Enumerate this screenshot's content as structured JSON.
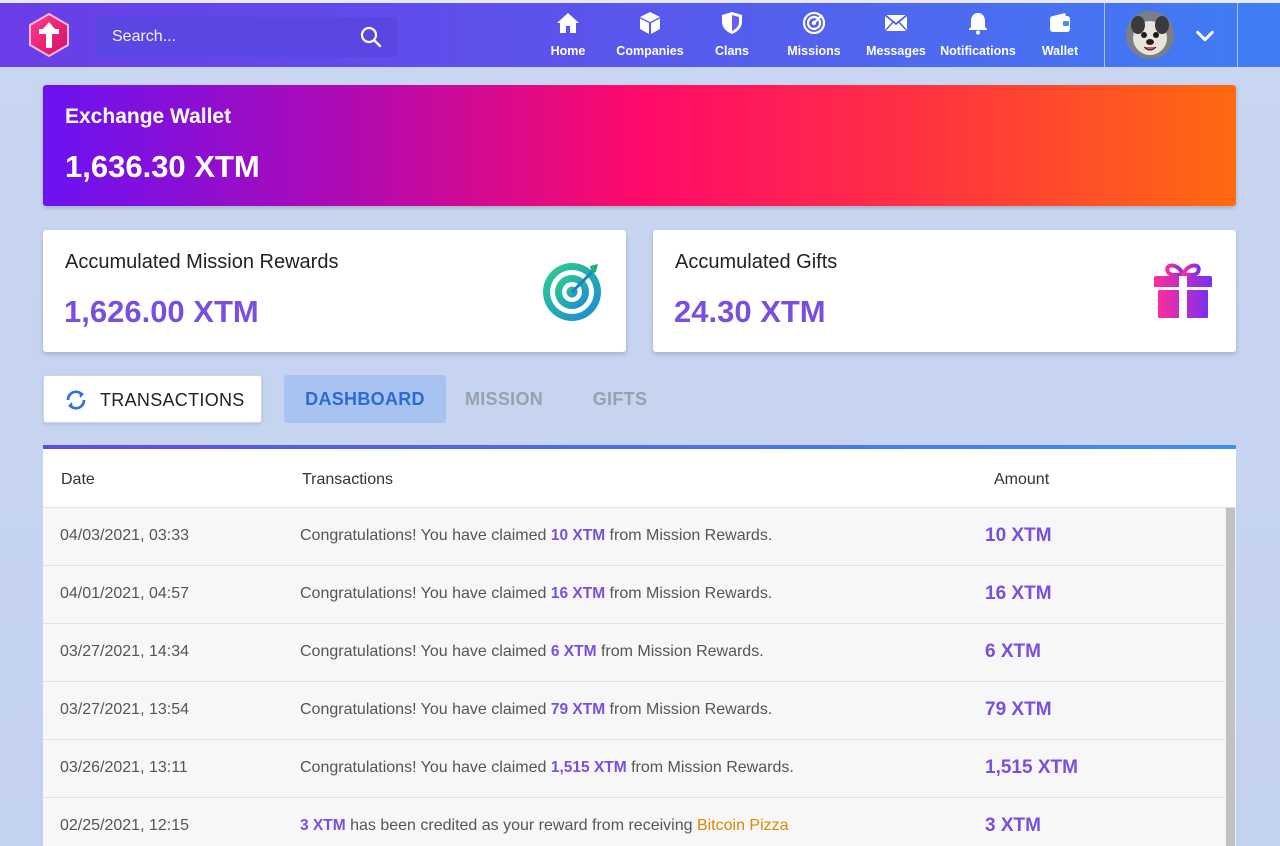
{
  "header": {
    "search_placeholder": "Search...",
    "nav": [
      {
        "label": "Home",
        "icon": "home-icon"
      },
      {
        "label": "Companies",
        "icon": "cube-icon"
      },
      {
        "label": "Clans",
        "icon": "shield-icon"
      },
      {
        "label": "Missions",
        "icon": "target-icon"
      },
      {
        "label": "Messages",
        "icon": "envelope-icon"
      },
      {
        "label": "Notifications",
        "icon": "bell-icon"
      },
      {
        "label": "Wallet",
        "icon": "wallet-icon"
      }
    ]
  },
  "wallet": {
    "title": "Exchange Wallet",
    "amount": "1,636.30 XTM"
  },
  "stats": {
    "mission": {
      "label": "Accumulated Mission Rewards",
      "value": "1,626.00 XTM",
      "icon": "target-icon"
    },
    "gifts": {
      "label": "Accumulated Gifts",
      "value": "24.30 XTM",
      "icon": "gift-icon"
    }
  },
  "tabs": {
    "transactions_button": "TRANSACTIONS",
    "dashboard": "DASHBOARD",
    "mission": "MISSION",
    "gifts": "GIFTS",
    "active": "dashboard"
  },
  "table": {
    "headers": {
      "date": "Date",
      "transactions": "Transactions",
      "amount": "Amount"
    },
    "rows": [
      {
        "date": "04/03/2021, 03:33",
        "pre": "Congratulations! You have claimed ",
        "hl": "10 XTM",
        "post": " from Mission Rewards.",
        "amount": "10 XTM"
      },
      {
        "date": "04/01/2021, 04:57",
        "pre": "Congratulations! You have claimed ",
        "hl": "16 XTM",
        "post": " from Mission Rewards.",
        "amount": "16 XTM"
      },
      {
        "date": "03/27/2021, 14:34",
        "pre": "Congratulations! You have claimed ",
        "hl": "6 XTM",
        "post": " from Mission Rewards.",
        "amount": "6 XTM"
      },
      {
        "date": "03/27/2021, 13:54",
        "pre": "Congratulations! You have claimed ",
        "hl": "79 XTM",
        "post": " from Mission Rewards.",
        "amount": "79 XTM"
      },
      {
        "date": "03/26/2021, 13:11",
        "pre": "Congratulations! You have claimed ",
        "hl": "1,515 XTM",
        "post": " from Mission Rewards.",
        "amount": "1,515 XTM"
      },
      {
        "date": "02/25/2021, 12:15",
        "hl_first": "3 XTM",
        "mid": " has been credited as your reward from receiving ",
        "link": "Bitcoin Pizza",
        "amount": "3 XTM"
      }
    ]
  },
  "colors": {
    "accent": "#7a4fe0",
    "nav_start": "#6a3de8",
    "nav_end": "#3f7ef4",
    "link_orange": "#d98a00",
    "active_tab": "#2e6ad6"
  }
}
